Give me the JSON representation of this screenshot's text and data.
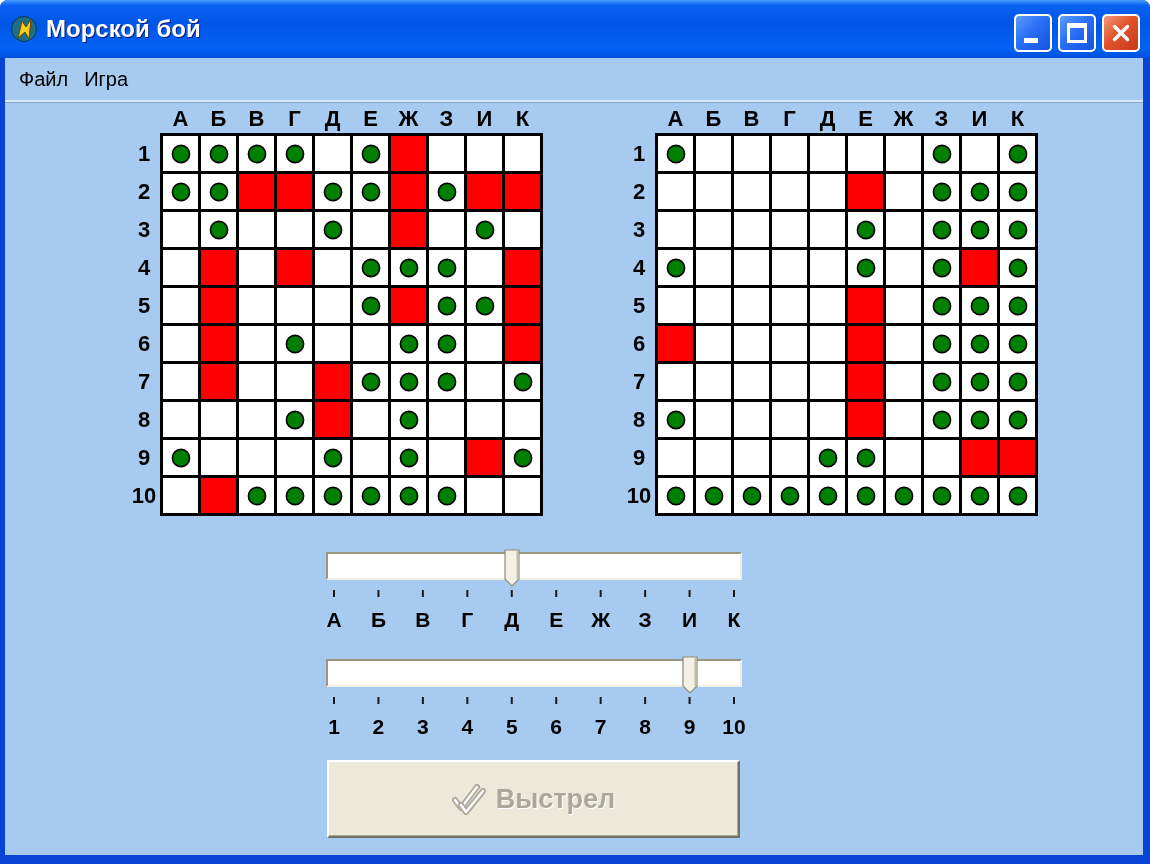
{
  "window": {
    "title": "Морской бой",
    "controls": [
      {
        "kind": "minimize"
      },
      {
        "kind": "maximize"
      },
      {
        "kind": "close"
      }
    ]
  },
  "menu": [
    "Файл",
    "Игра"
  ],
  "boards": [
    {
      "columns": [
        "А",
        "Б",
        "В",
        "Г",
        "Д",
        "Е",
        "Ж",
        "З",
        "И",
        "К"
      ],
      "rows": [
        {
          "label": "1",
          "cells": [
            {
              "kind": "miss"
            },
            {
              "kind": "miss"
            },
            {
              "kind": "miss"
            },
            {
              "kind": "miss"
            },
            {
              "kind": "empty"
            },
            {
              "kind": "miss"
            },
            {
              "kind": "hit"
            },
            {
              "kind": "empty"
            },
            {
              "kind": "empty"
            },
            {
              "kind": "empty"
            }
          ]
        },
        {
          "label": "2",
          "cells": [
            {
              "kind": "miss"
            },
            {
              "kind": "miss"
            },
            {
              "kind": "hit"
            },
            {
              "kind": "hit"
            },
            {
              "kind": "miss"
            },
            {
              "kind": "miss"
            },
            {
              "kind": "hit"
            },
            {
              "kind": "miss"
            },
            {
              "kind": "hit"
            },
            {
              "kind": "hit"
            }
          ]
        },
        {
          "label": "3",
          "cells": [
            {
              "kind": "empty"
            },
            {
              "kind": "miss"
            },
            {
              "kind": "empty"
            },
            {
              "kind": "empty"
            },
            {
              "kind": "miss"
            },
            {
              "kind": "empty"
            },
            {
              "kind": "hit"
            },
            {
              "kind": "empty"
            },
            {
              "kind": "miss"
            },
            {
              "kind": "empty"
            }
          ]
        },
        {
          "label": "4",
          "cells": [
            {
              "kind": "empty"
            },
            {
              "kind": "hit"
            },
            {
              "kind": "empty"
            },
            {
              "kind": "hit"
            },
            {
              "kind": "empty"
            },
            {
              "kind": "miss"
            },
            {
              "kind": "miss"
            },
            {
              "kind": "miss"
            },
            {
              "kind": "empty"
            },
            {
              "kind": "hit"
            }
          ]
        },
        {
          "label": "5",
          "cells": [
            {
              "kind": "empty"
            },
            {
              "kind": "hit"
            },
            {
              "kind": "empty"
            },
            {
              "kind": "empty"
            },
            {
              "kind": "empty"
            },
            {
              "kind": "miss"
            },
            {
              "kind": "hit"
            },
            {
              "kind": "miss"
            },
            {
              "kind": "miss"
            },
            {
              "kind": "hit"
            }
          ]
        },
        {
          "label": "6",
          "cells": [
            {
              "kind": "empty"
            },
            {
              "kind": "hit"
            },
            {
              "kind": "empty"
            },
            {
              "kind": "miss"
            },
            {
              "kind": "empty"
            },
            {
              "kind": "empty"
            },
            {
              "kind": "miss"
            },
            {
              "kind": "miss"
            },
            {
              "kind": "empty"
            },
            {
              "kind": "hit"
            }
          ]
        },
        {
          "label": "7",
          "cells": [
            {
              "kind": "empty"
            },
            {
              "kind": "hit"
            },
            {
              "kind": "empty"
            },
            {
              "kind": "empty"
            },
            {
              "kind": "hit"
            },
            {
              "kind": "miss"
            },
            {
              "kind": "miss"
            },
            {
              "kind": "miss"
            },
            {
              "kind": "empty"
            },
            {
              "kind": "miss"
            }
          ]
        },
        {
          "label": "8",
          "cells": [
            {
              "kind": "empty"
            },
            {
              "kind": "empty"
            },
            {
              "kind": "empty"
            },
            {
              "kind": "miss"
            },
            {
              "kind": "hit"
            },
            {
              "kind": "empty"
            },
            {
              "kind": "miss"
            },
            {
              "kind": "empty"
            },
            {
              "kind": "empty"
            },
            {
              "kind": "empty"
            }
          ]
        },
        {
          "label": "9",
          "cells": [
            {
              "kind": "miss"
            },
            {
              "kind": "empty"
            },
            {
              "kind": "empty"
            },
            {
              "kind": "empty"
            },
            {
              "kind": "miss"
            },
            {
              "kind": "empty"
            },
            {
              "kind": "miss"
            },
            {
              "kind": "empty"
            },
            {
              "kind": "hit"
            },
            {
              "kind": "miss"
            }
          ]
        },
        {
          "label": "10",
          "cells": [
            {
              "kind": "empty"
            },
            {
              "kind": "hit"
            },
            {
              "kind": "miss"
            },
            {
              "kind": "miss"
            },
            {
              "kind": "miss"
            },
            {
              "kind": "miss"
            },
            {
              "kind": "miss"
            },
            {
              "kind": "miss"
            },
            {
              "kind": "empty"
            },
            {
              "kind": "empty"
            }
          ]
        }
      ]
    },
    {
      "columns": [
        "А",
        "Б",
        "В",
        "Г",
        "Д",
        "Е",
        "Ж",
        "З",
        "И",
        "К"
      ],
      "rows": [
        {
          "label": "1",
          "cells": [
            {
              "kind": "miss"
            },
            {
              "kind": "empty"
            },
            {
              "kind": "empty"
            },
            {
              "kind": "empty"
            },
            {
              "kind": "empty"
            },
            {
              "kind": "empty"
            },
            {
              "kind": "empty"
            },
            {
              "kind": "miss"
            },
            {
              "kind": "empty"
            },
            {
              "kind": "miss"
            }
          ]
        },
        {
          "label": "2",
          "cells": [
            {
              "kind": "empty"
            },
            {
              "kind": "empty"
            },
            {
              "kind": "empty"
            },
            {
              "kind": "empty"
            },
            {
              "kind": "empty"
            },
            {
              "kind": "hit"
            },
            {
              "kind": "empty"
            },
            {
              "kind": "miss"
            },
            {
              "kind": "miss"
            },
            {
              "kind": "miss"
            }
          ]
        },
        {
          "label": "3",
          "cells": [
            {
              "kind": "empty"
            },
            {
              "kind": "empty"
            },
            {
              "kind": "empty"
            },
            {
              "kind": "empty"
            },
            {
              "kind": "empty"
            },
            {
              "kind": "miss"
            },
            {
              "kind": "empty"
            },
            {
              "kind": "miss"
            },
            {
              "kind": "miss"
            },
            {
              "kind": "miss"
            }
          ]
        },
        {
          "label": "4",
          "cells": [
            {
              "kind": "miss"
            },
            {
              "kind": "empty"
            },
            {
              "kind": "empty"
            },
            {
              "kind": "empty"
            },
            {
              "kind": "empty"
            },
            {
              "kind": "miss"
            },
            {
              "kind": "empty"
            },
            {
              "kind": "miss"
            },
            {
              "kind": "hit"
            },
            {
              "kind": "miss"
            }
          ]
        },
        {
          "label": "5",
          "cells": [
            {
              "kind": "empty"
            },
            {
              "kind": "empty"
            },
            {
              "kind": "empty"
            },
            {
              "kind": "empty"
            },
            {
              "kind": "empty"
            },
            {
              "kind": "hit"
            },
            {
              "kind": "empty"
            },
            {
              "kind": "miss"
            },
            {
              "kind": "miss"
            },
            {
              "kind": "miss"
            }
          ]
        },
        {
          "label": "6",
          "cells": [
            {
              "kind": "hit"
            },
            {
              "kind": "empty"
            },
            {
              "kind": "empty"
            },
            {
              "kind": "empty"
            },
            {
              "kind": "empty"
            },
            {
              "kind": "hit"
            },
            {
              "kind": "empty"
            },
            {
              "kind": "miss"
            },
            {
              "kind": "miss"
            },
            {
              "kind": "miss"
            }
          ]
        },
        {
          "label": "7",
          "cells": [
            {
              "kind": "empty"
            },
            {
              "kind": "empty"
            },
            {
              "kind": "empty"
            },
            {
              "kind": "empty"
            },
            {
              "kind": "empty"
            },
            {
              "kind": "hit"
            },
            {
              "kind": "empty"
            },
            {
              "kind": "miss"
            },
            {
              "kind": "miss"
            },
            {
              "kind": "miss"
            }
          ]
        },
        {
          "label": "8",
          "cells": [
            {
              "kind": "miss"
            },
            {
              "kind": "empty"
            },
            {
              "kind": "empty"
            },
            {
              "kind": "empty"
            },
            {
              "kind": "empty"
            },
            {
              "kind": "hit"
            },
            {
              "kind": "empty"
            },
            {
              "kind": "miss"
            },
            {
              "kind": "miss"
            },
            {
              "kind": "miss"
            }
          ]
        },
        {
          "label": "9",
          "cells": [
            {
              "kind": "empty"
            },
            {
              "kind": "empty"
            },
            {
              "kind": "empty"
            },
            {
              "kind": "empty"
            },
            {
              "kind": "miss"
            },
            {
              "kind": "miss"
            },
            {
              "kind": "empty"
            },
            {
              "kind": "empty"
            },
            {
              "kind": "hit"
            },
            {
              "kind": "hit"
            }
          ]
        },
        {
          "label": "10",
          "cells": [
            {
              "kind": "miss"
            },
            {
              "kind": "miss"
            },
            {
              "kind": "miss"
            },
            {
              "kind": "miss"
            },
            {
              "kind": "miss"
            },
            {
              "kind": "miss"
            },
            {
              "kind": "miss"
            },
            {
              "kind": "miss"
            },
            {
              "kind": "miss"
            },
            {
              "kind": "miss"
            }
          ]
        }
      ]
    }
  ],
  "sliders": [
    {
      "level": 0.444,
      "ticks": [
        "А",
        "Б",
        "В",
        "Г",
        "Д",
        "Е",
        "Ж",
        "З",
        "И",
        "К"
      ]
    },
    {
      "level": 0.889,
      "ticks": [
        "1",
        "2",
        "3",
        "4",
        "5",
        "6",
        "7",
        "8",
        "9",
        "10"
      ]
    }
  ],
  "shoot_button": {
    "label": "Выстрел",
    "disabled": true
  }
}
